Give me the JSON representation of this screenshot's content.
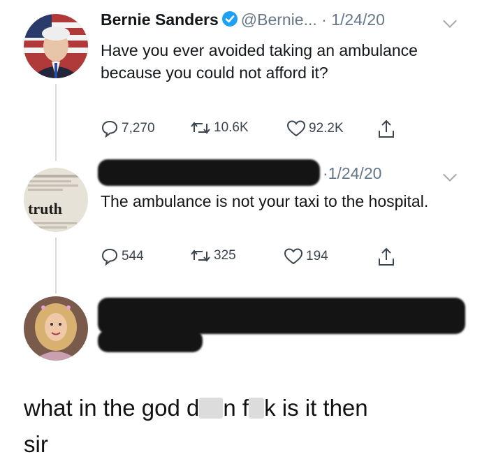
{
  "tweets": [
    {
      "name": "Bernie Sanders",
      "handle": "@Bernie...",
      "date": "· 1/24/20",
      "text": "Have you ever avoided taking an ambulance because you could not afford it?",
      "replies": "7,270",
      "retweets": "10.6K",
      "likes": "92.2K"
    },
    {
      "date": "·1/24/20",
      "avatar_text": "truth",
      "text": "The ambulance is not your taxi to the hospital.",
      "replies": "544",
      "retweets": "325",
      "likes": "194"
    }
  ],
  "caption": {
    "part1": "what in the god d",
    "part2": "n f",
    "part3": "k is it then",
    "part4": "sir"
  },
  "colors": {
    "verified": "#1da1f2",
    "text": "#14171a",
    "muted": "#657786",
    "redaction": "#141414"
  },
  "icons": [
    "verified-icon",
    "reply-icon",
    "retweet-icon",
    "like-icon",
    "share-icon",
    "chevron-down-icon"
  ]
}
